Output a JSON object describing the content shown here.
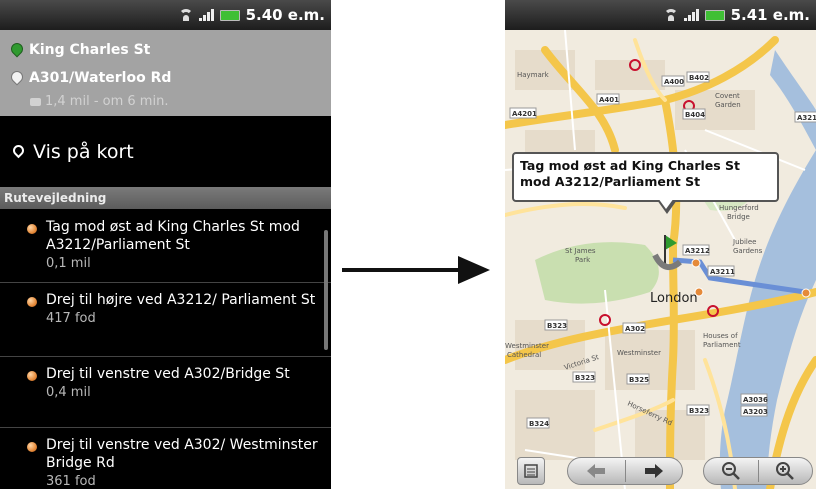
{
  "left_screen": {
    "status": {
      "time": "5.40 e.m."
    },
    "route": {
      "start": "King Charles St",
      "end": "A301/Waterloo Rd",
      "meta": "1,4 mil - om 6 min."
    },
    "show_on_map": "Vis på kort",
    "section_title": "Rutevejledning",
    "steps": [
      {
        "text": "Tag mod øst ad King Charles St mod A3212/Parliament St",
        "distance": "0,1 mil"
      },
      {
        "text": "Drej til højre ved A3212/ Parliament St",
        "distance": "417 fod"
      },
      {
        "text": "Drej til venstre ved A302/Bridge St",
        "distance": "0,4 mil"
      },
      {
        "text": "Drej til venstre ved A302/ Westminster Bridge Rd",
        "distance": "361 fod"
      }
    ]
  },
  "right_screen": {
    "status": {
      "time": "5.41 e.m."
    },
    "callout": "Tag mod øst ad King Charles St mod A3212/Parliament St",
    "map_labels": {
      "city": "London",
      "park": "St James Park",
      "westminster": "Westminster",
      "covent": "Covent Garden",
      "houses": "Houses of Parliament",
      "hungerford": "Hungerford Bridge",
      "jubilee": "Jubilee Gardens",
      "haymarket": "Haymark",
      "westminster_cathedral": "Westminster Cathedral",
      "victoria_st": "Victoria St",
      "horseferry": "Horseferry Rd"
    },
    "road_badges": [
      "A400",
      "B402",
      "A401",
      "B404",
      "A4201",
      "A3212",
      "A3211",
      "A302",
      "B323",
      "B325",
      "A3036",
      "A3203",
      "B324",
      "A321"
    ]
  },
  "colors": {
    "route_header": "#a3a3a3",
    "section_header": "#6b6b6b",
    "bullet": "#e58a3a",
    "map_bg": "#f1ebdf",
    "map_road_major": "#f4c64a",
    "map_water": "#a5bfdd",
    "map_park": "#c9dfb0"
  }
}
